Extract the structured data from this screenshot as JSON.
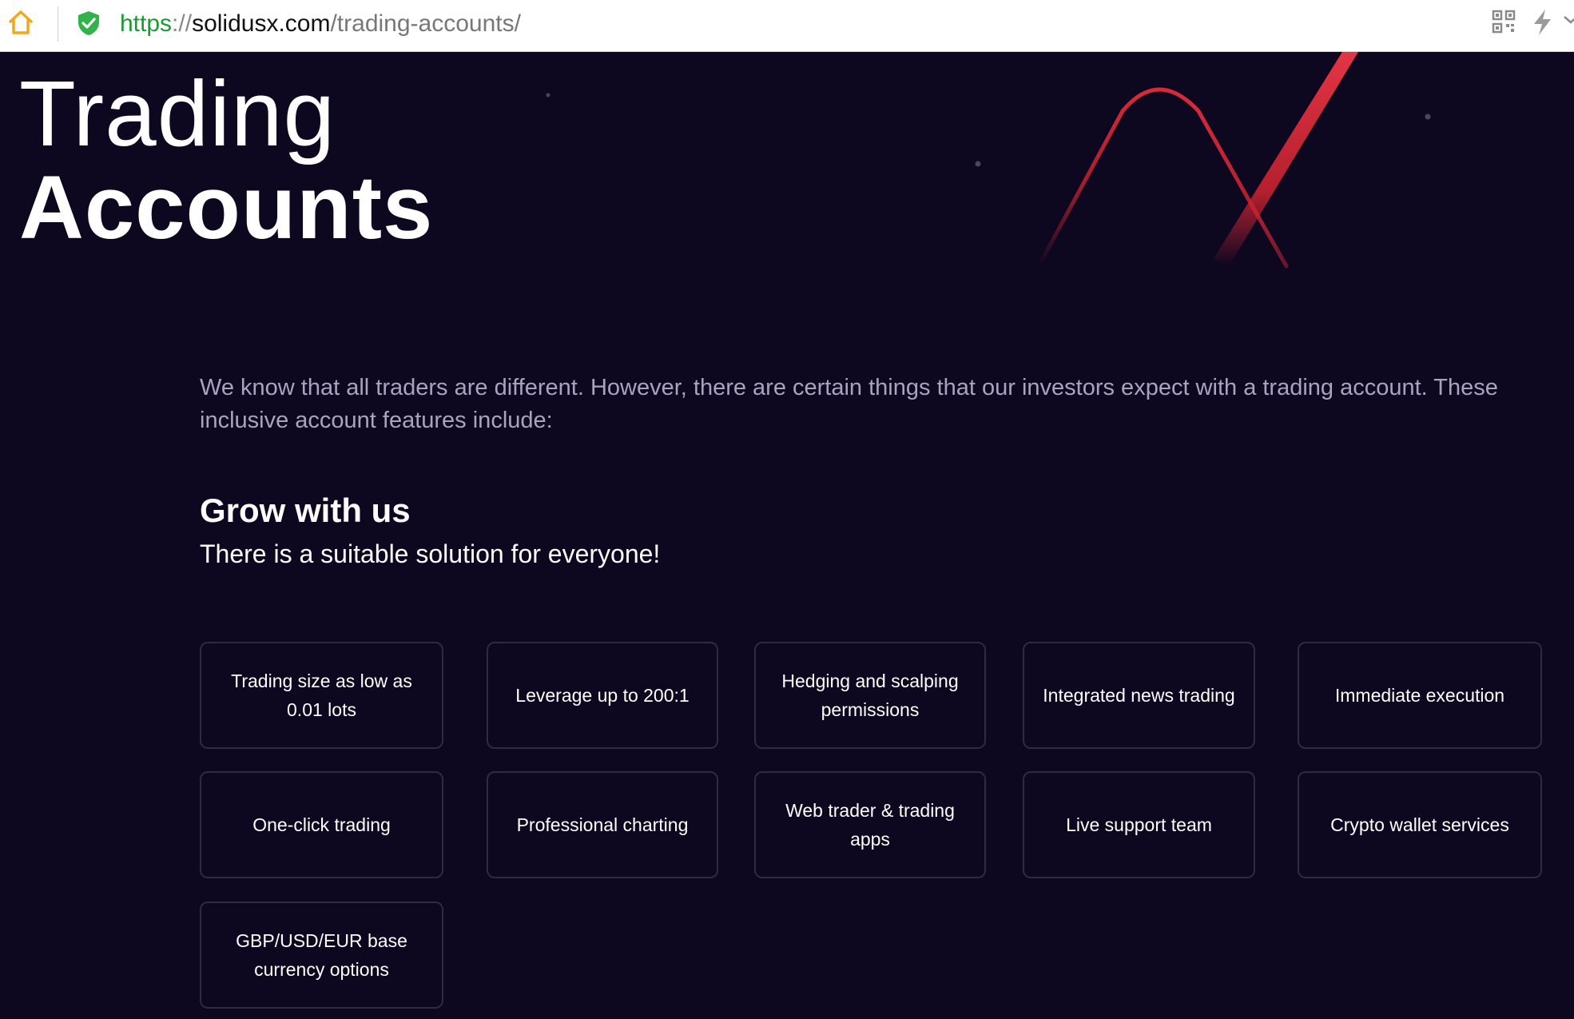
{
  "browser": {
    "url_scheme": "https",
    "url_separator": "://",
    "url_host": "solidusx.com",
    "url_path": "/trading-accounts/",
    "icons": [
      "home-icon",
      "shield-check-icon",
      "qr-code-icon",
      "bolt-icon",
      "chevron-down-icon"
    ]
  },
  "hero": {
    "title_line1": "Trading",
    "title_line2": "Accounts"
  },
  "intro": "We know that all traders are different. However, there are certain things that our investors expect with a trading account. These inclusive account features include:",
  "grow": {
    "title": "Grow with us",
    "subtitle": "There is a suitable solution for everyone!"
  },
  "features": [
    "Trading size as low as 0.01 lots",
    "Leverage up to 200:1",
    "Hedging and scalping permissions",
    "Integrated news trading",
    "Immediate execution",
    "One-click trading",
    "Professional charting",
    "Web trader & trading apps",
    "Live support team",
    "Crypto wallet services",
    "GBP/USD/EUR base currency options"
  ],
  "colors": {
    "background": "#0d0720",
    "accent_red": "#d42a3a",
    "card_border": "#2e2a44",
    "intro_text": "#a8a4bf"
  }
}
